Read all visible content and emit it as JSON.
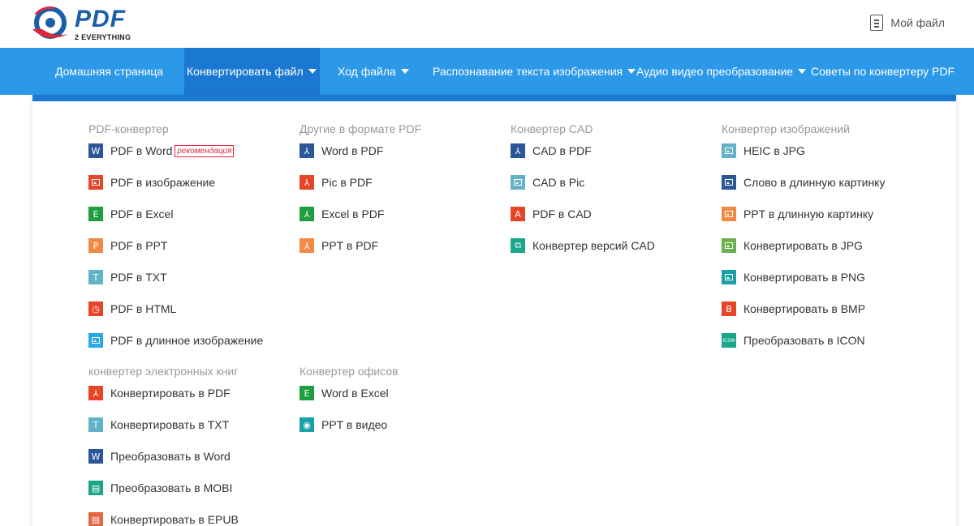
{
  "header": {
    "logo_title": "PDF",
    "logo_subtitle": "2 EVERYTHING",
    "my_file": "Мой файл"
  },
  "nav": {
    "items": [
      {
        "label": "Домашняя страница"
      },
      {
        "label": "Конвертировать файл"
      },
      {
        "label": "Ход файла"
      },
      {
        "label": "Распознавание текста изображения"
      },
      {
        "label": "Аудио видео преобразование"
      },
      {
        "label": "Советы по конвертеру PDF"
      }
    ]
  },
  "menu": {
    "pdf_converter": {
      "title": "PDF-конвертер",
      "items": [
        {
          "label": "PDF в Word",
          "badge": "рекомендация",
          "icon": "word-icon",
          "color": "#2b5797"
        },
        {
          "label": "PDF в изображение",
          "icon": "image-icon",
          "color": "#e64528"
        },
        {
          "label": "PDF в Excel",
          "icon": "excel-icon",
          "color": "#1e9e3e"
        },
        {
          "label": "PDF в PPT",
          "icon": "ppt-icon",
          "color": "#f08a45"
        },
        {
          "label": "PDF в TXT",
          "icon": "txt-icon",
          "color": "#62b2c9"
        },
        {
          "label": "PDF в HTML",
          "icon": "html-icon",
          "color": "#e64528"
        },
        {
          "label": "PDF в длинное изображение",
          "icon": "long-image-icon",
          "color": "#2aa8e8"
        }
      ]
    },
    "ebook_converter": {
      "title": "конвертер электронных книг",
      "items": [
        {
          "label": "Конвертировать в PDF",
          "icon": "pdf-icon",
          "color": "#e64528"
        },
        {
          "label": "Конвертировать в TXT",
          "icon": "txt-icon",
          "color": "#62b2c9"
        },
        {
          "label": "Преобразовать в Word",
          "icon": "word-icon",
          "color": "#2b5797"
        },
        {
          "label": "Преобразовать в MOBI",
          "icon": "mobi-icon",
          "color": "#1aa68a"
        },
        {
          "label": "Конвертировать в EPUB",
          "icon": "epub-icon",
          "color": "#e3663e"
        }
      ]
    },
    "other_to_pdf": {
      "title": "Другие в формате PDF",
      "items": [
        {
          "label": "Word в PDF",
          "icon": "word-pdf-icon",
          "color": "#2b5797"
        },
        {
          "label": "Pic в PDF",
          "icon": "pic-pdf-icon",
          "color": "#e64528"
        },
        {
          "label": "Excel в PDF",
          "icon": "excel-pdf-icon",
          "color": "#1e9e3e"
        },
        {
          "label": "PPT в PDF",
          "icon": "ppt-pdf-icon",
          "color": "#f08a45"
        }
      ]
    },
    "office_converter": {
      "title": "Конвертер офисов",
      "items": [
        {
          "label": "Word в Excel",
          "icon": "excel-icon",
          "color": "#1e9e3e"
        },
        {
          "label": "PPT в видео",
          "icon": "video-icon",
          "color": "#1aa0a8"
        }
      ]
    },
    "cad_converter": {
      "title": "Конвертер CAD",
      "items": [
        {
          "label": "CAD в PDF",
          "icon": "cad-pdf-icon",
          "color": "#2b5797"
        },
        {
          "label": "CAD в Pic",
          "icon": "cad-pic-icon",
          "color": "#62b2c9"
        },
        {
          "label": "PDF в CAD",
          "icon": "pdf-cad-icon",
          "color": "#e64528"
        },
        {
          "label": "Конвертер версий CAD",
          "icon": "cad-version-icon",
          "color": "#1aa68a"
        }
      ]
    },
    "image_converter": {
      "title": "Конвертер изображений",
      "items": [
        {
          "label": "HEIC в JPG",
          "icon": "heic-icon",
          "color": "#62b2c9"
        },
        {
          "label": "Слово в длинную картинку",
          "icon": "word-long-image-icon",
          "color": "#2b5797"
        },
        {
          "label": "PPT в длинную картинку",
          "icon": "ppt-long-image-icon",
          "color": "#f08a45"
        },
        {
          "label": "Конвертировать в JPG",
          "icon": "jpg-icon",
          "color": "#6ab04c"
        },
        {
          "label": "Конвертировать в PNG",
          "icon": "png-icon",
          "color": "#1aa0a8"
        },
        {
          "label": "Конвертировать в BMP",
          "icon": "bmp-icon",
          "color": "#e64528"
        },
        {
          "label": "Преобразовать в ICON",
          "icon": "icon-icon",
          "color": "#1aa68a"
        }
      ]
    }
  }
}
